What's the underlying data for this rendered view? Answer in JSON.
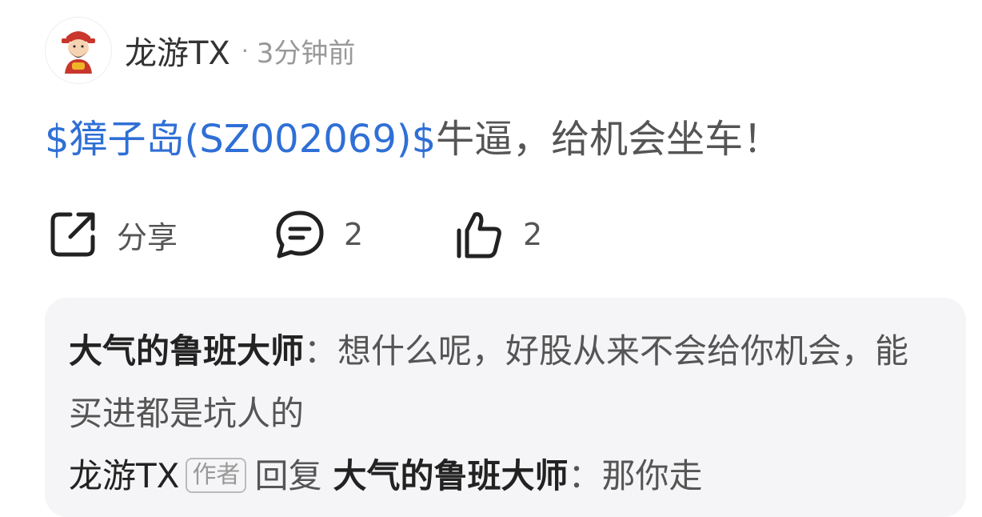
{
  "post": {
    "author": "龙游TX",
    "separator": "·",
    "time": "3分钟前",
    "stock_link": "$獐子岛(SZ002069)$",
    "text": "牛逼，给机会坐车！"
  },
  "actions": {
    "share_label": "分享",
    "comment_count": "2",
    "like_count": "2",
    "icons": [
      "share-icon",
      "comment-icon",
      "thumbs-up-icon"
    ]
  },
  "replies": {
    "first": {
      "name": "大气的鲁班大师",
      "separator": "：",
      "text": "想什么呢，好股从来不会给你机会，能买进都是坑人的"
    },
    "second": {
      "author": "龙游TX",
      "badge": "作者",
      "reply_word": "回复",
      "target": "大气的鲁班大师",
      "separator": "：",
      "text": "那你走"
    }
  },
  "colors": {
    "link": "#2f6fd6",
    "reply_background": "#f5f5f7",
    "muted_text": "#999999"
  }
}
